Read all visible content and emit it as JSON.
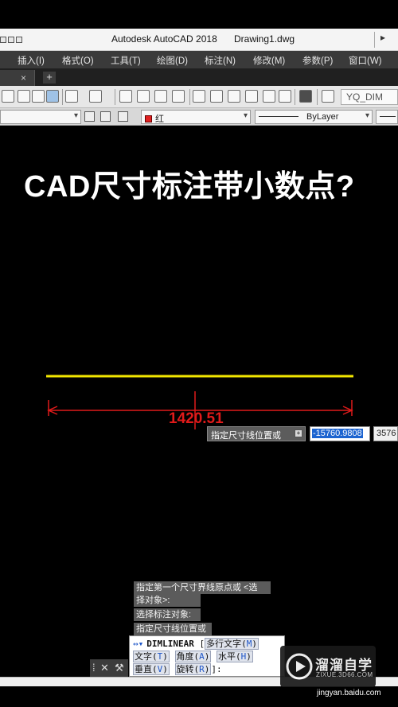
{
  "title_bar": {
    "app_name": "Autodesk AutoCAD 2018",
    "document_name": "Drawing1.dwg"
  },
  "menu": [
    "插入(I)",
    "格式(O)",
    "工具(T)",
    "绘图(D)",
    "标注(N)",
    "修改(M)",
    "参数(P)",
    "窗口(W)"
  ],
  "tabs": {
    "close_glyph": "×",
    "add_glyph": "+"
  },
  "toolbar": {
    "text_style": "YQ_DIM"
  },
  "properties": {
    "color": {
      "label": "红",
      "hex": "#e02020"
    },
    "linetype": "ByLayer"
  },
  "canvas": {
    "headline": "CAD尺寸标注带小数点?",
    "dimension_value": "1420.51",
    "line_color": "#f2e600",
    "dimension_color": "#e01a1a"
  },
  "dynamic_input": {
    "prompt": "指定尺寸线位置或",
    "value_1": "-15760.9808",
    "value_2": "3576"
  },
  "command_history": [
    "指定第一个尺寸界线原点或 <选",
    "择对象>:",
    "选择标注对象:",
    "指定尺寸线位置或"
  ],
  "command_line": {
    "command": "DIMLINEAR",
    "options": [
      {
        "label": "多行文字",
        "key": "M"
      },
      {
        "label": "文字",
        "key": "T"
      },
      {
        "label": "角度",
        "key": "A"
      },
      {
        "label": "水平",
        "key": "H"
      },
      {
        "label": "垂直",
        "key": "V"
      },
      {
        "label": "旋转",
        "key": "R"
      }
    ]
  },
  "watermark": {
    "name": "溜溜自学",
    "url": "ZIXUE.3D66.COM"
  },
  "source": "jingyan.baidu.com"
}
